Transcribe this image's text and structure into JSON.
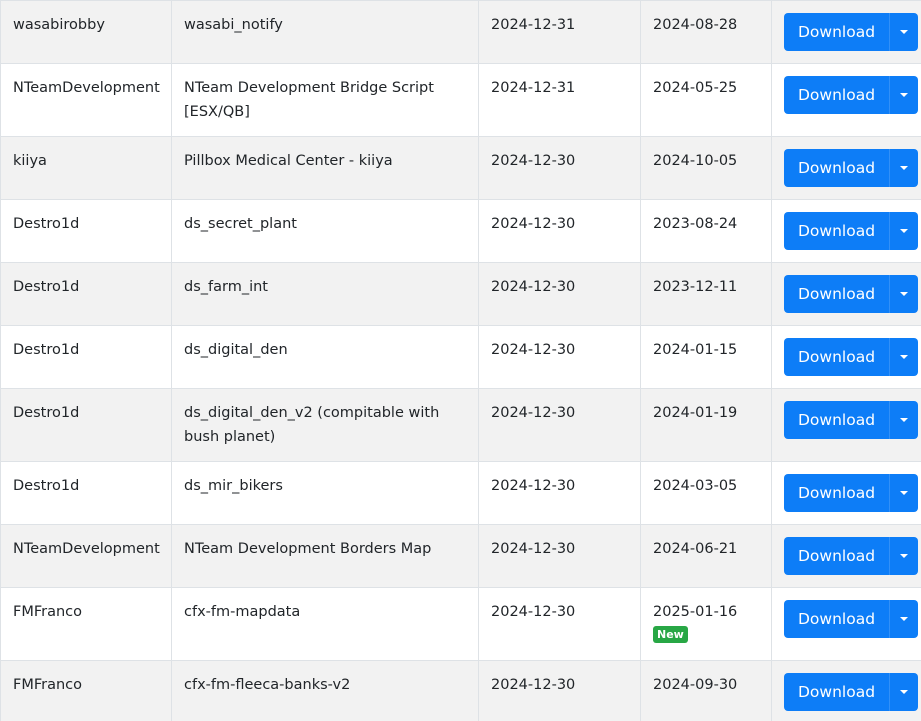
{
  "table": {
    "rows": [
      {
        "author": "wasabirobby",
        "name": "wasabi_notify",
        "date1": "2024-12-31",
        "date2": "2024-08-28",
        "badge": "",
        "download_label": "Download"
      },
      {
        "author": "NTeamDevelopment",
        "name": "NTeam Development Bridge Script [ESX/QB]",
        "date1": "2024-12-31",
        "date2": "2024-05-25",
        "badge": "",
        "download_label": "Download"
      },
      {
        "author": "kiiya",
        "name": "Pillbox Medical Center - kiiya",
        "date1": "2024-12-30",
        "date2": "2024-10-05",
        "badge": "",
        "download_label": "Download"
      },
      {
        "author": "Destro1d",
        "name": "ds_secret_plant",
        "date1": "2024-12-30",
        "date2": "2023-08-24",
        "badge": "",
        "download_label": "Download"
      },
      {
        "author": "Destro1d",
        "name": "ds_farm_int",
        "date1": "2024-12-30",
        "date2": "2023-12-11",
        "badge": "",
        "download_label": "Download"
      },
      {
        "author": "Destro1d",
        "name": "ds_digital_den",
        "date1": "2024-12-30",
        "date2": "2024-01-15",
        "badge": "",
        "download_label": "Download"
      },
      {
        "author": "Destro1d",
        "name": "ds_digital_den_v2 (compitable with bush planet)",
        "date1": "2024-12-30",
        "date2": "2024-01-19",
        "badge": "",
        "download_label": "Download"
      },
      {
        "author": "Destro1d",
        "name": "ds_mir_bikers",
        "date1": "2024-12-30",
        "date2": "2024-03-05",
        "badge": "",
        "download_label": "Download"
      },
      {
        "author": "NTeamDevelopment",
        "name": "NTeam Development Borders Map",
        "date1": "2024-12-30",
        "date2": "2024-06-21",
        "badge": "",
        "download_label": "Download"
      },
      {
        "author": "FMFranco",
        "name": "cfx-fm-mapdata",
        "date1": "2024-12-30",
        "date2": "2025-01-16",
        "badge": "New",
        "download_label": "Download"
      },
      {
        "author": "FMFranco",
        "name": "cfx-fm-fleeca-banks-v2",
        "date1": "2024-12-30",
        "date2": "2024-09-30",
        "badge": "",
        "download_label": "Download"
      }
    ]
  },
  "icons": {
    "dropdown": "caret-down-icon"
  },
  "colors": {
    "button": "#0d7df7",
    "badge_new": "#28a745",
    "row_striped": "#f2f2f2"
  }
}
